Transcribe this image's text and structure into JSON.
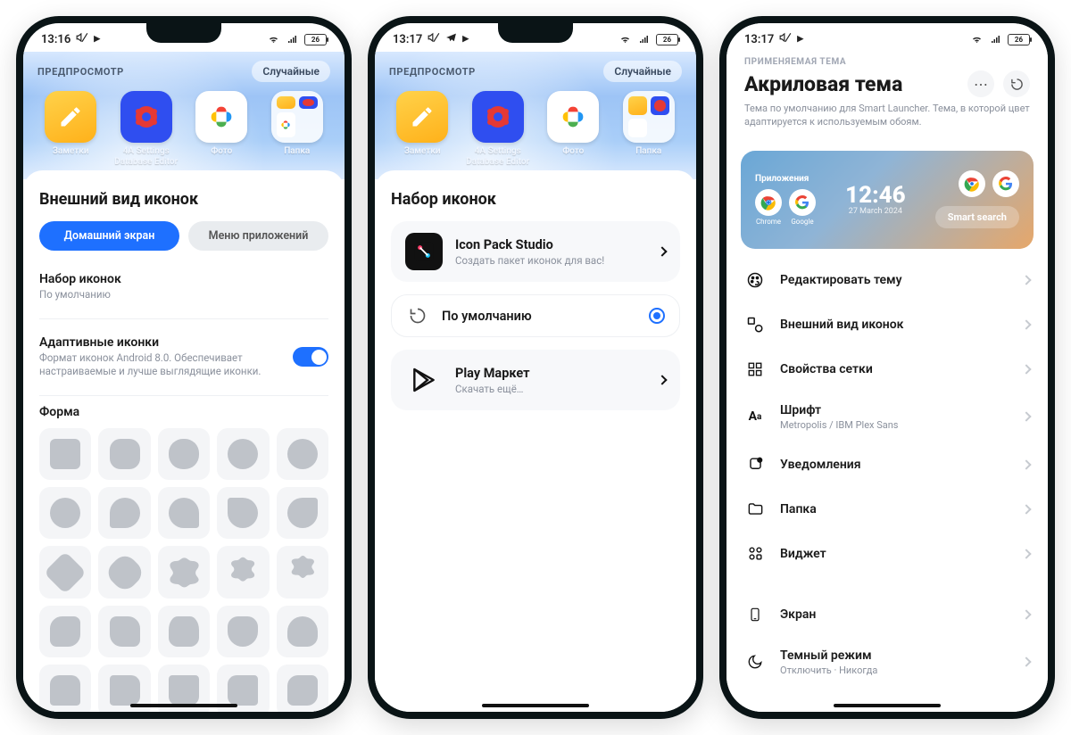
{
  "statusbar": {
    "time1": "13:16",
    "time2": "13:17",
    "time3": "13:17",
    "battery": "26"
  },
  "preview": {
    "caption": "ПРЕДПРОСМОТР",
    "random_chip": "Случайные",
    "apps": {
      "notes": "Заметки",
      "settings_db": "4A Settings Database Editor",
      "photos": "Фото",
      "folder": "Папка"
    }
  },
  "screen1": {
    "title": "Внешний вид иконок",
    "tab_home": "Домашний экран",
    "tab_apps": "Меню приложений",
    "iconset_title": "Набор иконок",
    "iconset_sub": "По умолчанию",
    "adaptive_title": "Адаптивные иконки",
    "adaptive_sub": "Формат иконок Android 8.0. Обеспечивает настраиваемые и лучше выглядящие иконки.",
    "shape_section": "Форма"
  },
  "screen2": {
    "title": "Набор иконок",
    "ips_title": "Icon Pack Studio",
    "ips_sub": "Создать пакет иконок для вас!",
    "default_label": "По умолчанию",
    "play_title": "Play Маркет",
    "play_sub": "Скачать ещё…"
  },
  "screen3": {
    "caption": "ПРИМЕНЯЕМАЯ ТЕМА",
    "title": "Акриловая тема",
    "desc": "Тема по умолчанию для Smart Launcher. Тема, в которой цвет адаптируется к используемым обоям.",
    "banner": {
      "apps_label": "Приложения",
      "chrome": "Chrome",
      "google": "Google",
      "time": "12:46",
      "date": "27 March 2024",
      "search": "Smart search"
    },
    "menu": {
      "edit_theme": "Редактировать тему",
      "icon_appearance": "Внешний вид иконок",
      "grid": "Свойства сетки",
      "font": "Шрифт",
      "font_sub": "Metropolis / IBM Plex Sans",
      "notifications": "Уведомления",
      "folder": "Папка",
      "widget": "Виджет",
      "screen": "Экран",
      "dark": "Темный режим",
      "dark_sub": "Отключить · Никогда"
    }
  }
}
